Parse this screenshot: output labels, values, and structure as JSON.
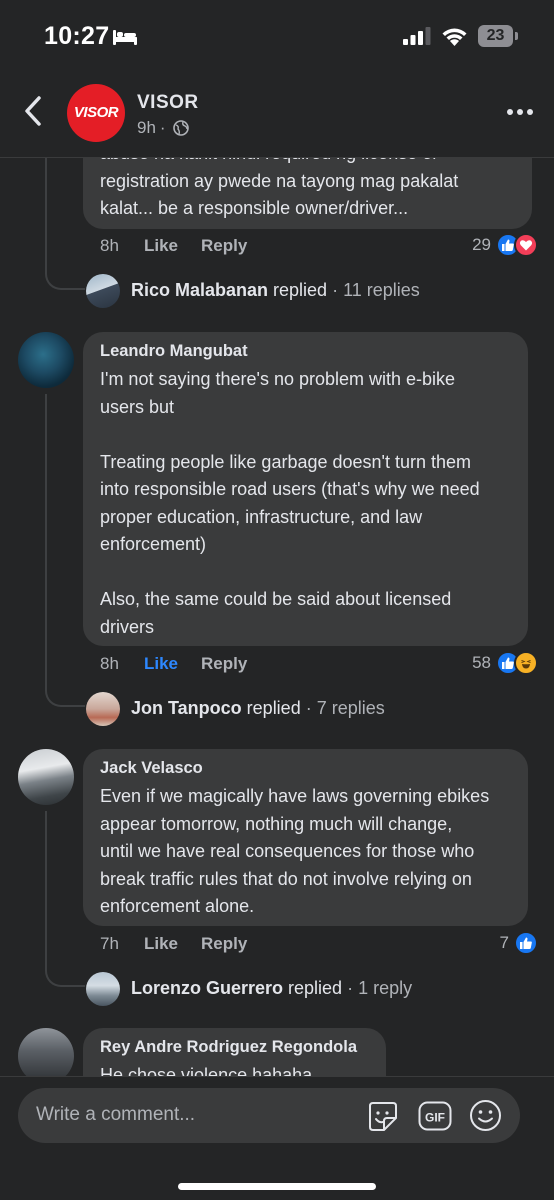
{
  "status_bar": {
    "time": "10:27",
    "battery": "23"
  },
  "header": {
    "page_name": "VISOR",
    "avatar_text": "VISOR",
    "post_age": "9h",
    "separator": "·"
  },
  "top_comment": {
    "text": "abuse na kahit hindi required ng license or\nregistration ay pwede na tayong mag pakalat\nkalat... be a responsible owner/driver...",
    "time": "8h",
    "like_label": "Like",
    "reply_label": "Reply",
    "reaction_count": "29",
    "reactions": [
      "like",
      "love"
    ],
    "replied": {
      "name": "Rico Malabanan",
      "word": "replied",
      "count": "· 11 replies"
    }
  },
  "comments": [
    {
      "author": "Leandro Mangubat",
      "text": "I'm not saying there's no problem with e-bike\nusers but\n\nTreating people like garbage doesn't turn them\ninto responsible road users (that's why we need\nproper education, infrastructure, and law\nenforcement)\n\nAlso, the same could be said about licensed\ndrivers",
      "time": "8h",
      "like_label": "Like",
      "like_active": true,
      "reply_label": "Reply",
      "reaction_count": "58",
      "reactions": [
        "like",
        "haha"
      ],
      "replied": {
        "name": "Jon Tanpoco",
        "word": "replied",
        "count": "· 7 replies"
      }
    },
    {
      "author": "Jack Velasco",
      "text": "Even if we magically have laws governing ebikes\nappear tomorrow, nothing much will change,\nuntil we have real consequences for those who\nbreak traffic rules that do not involve relying on\nenforcement alone.",
      "time": "7h",
      "like_label": "Like",
      "like_active": false,
      "reply_label": "Reply",
      "reaction_count": "7",
      "reactions": [
        "like"
      ],
      "replied": {
        "name": "Lorenzo Guerrero",
        "word": "replied",
        "count": "· 1 reply"
      }
    },
    {
      "author": "Rey Andre Rodriguez Regondola",
      "text": "He chose violence hahaha"
    }
  ],
  "composer": {
    "placeholder": "Write a comment..."
  },
  "colors": {
    "background": "#242526",
    "bubble": "#3a3b3c",
    "accent": "#2d88ff",
    "brand_red": "#e41e26"
  }
}
